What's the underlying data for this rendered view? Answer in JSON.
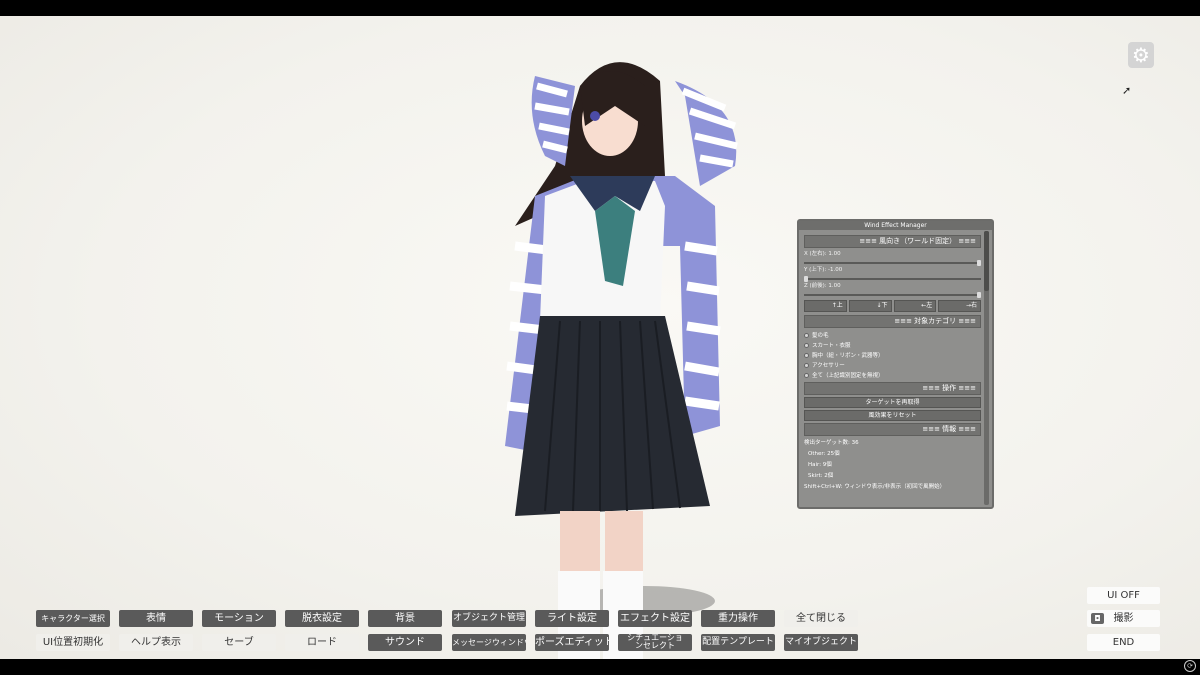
{
  "settings_icon": "gear-icon",
  "wind_panel": {
    "title": "Wind Effect Manager",
    "direction_header": "≡≡≡ 風向き（ワールド固定） ≡≡≡",
    "x_label": "X (左右): 1.00",
    "y_label": "Y (上下): -1.00",
    "z_label": "Z (前後): 1.00",
    "x_value": 1.0,
    "y_value": -1.0,
    "z_value": 1.0,
    "dir_up": "↑上",
    "dir_down": "↓下",
    "dir_left": "←左",
    "dir_right": "→右",
    "category_header": "≡≡≡ 対象カテゴリ ≡≡≡",
    "categories": [
      "髪の毛",
      "スカート・衣服",
      "胸中（紐・リボン・武器等）",
      "アクセサリー",
      "全て（上記識別固定を無視）"
    ],
    "ops_header": "≡≡≡ 操作 ≡≡≡",
    "retarget_button": "ターゲットを再取得",
    "reset_button": "風効果をリセット",
    "info_header": "≡≡≡ 情報 ≡≡≡",
    "detect_count": "検出ターゲット数: 36",
    "other_count": "Other: 25個",
    "hair_count": "Hair: 9個",
    "skirt_count": "Skirt: 2個",
    "hint": "Shift+Ctrl+W: ウィンドウ表示/非表示（初回で風開始）"
  },
  "toolbar": {
    "row1": [
      "キャラクター選択",
      "表情",
      "モーション",
      "脱衣設定",
      "背景",
      "オブジェクト管理",
      "ライト設定",
      "エフェクト設定",
      "重力操作",
      "全て閉じる"
    ],
    "row2": [
      "UI位置初期化",
      "ヘルプ表示",
      "セーブ",
      "ロード",
      "サウンド",
      "メッセージウィンドウ",
      "ポーズエディット",
      "シチュエーションセレクト",
      "配置テンプレート",
      "マイオブジェクト"
    ]
  },
  "right_buttons": {
    "ui_off": "UI OFF",
    "capture": "撮影",
    "end": "END"
  },
  "colors": {
    "dark_button": "#5a5a5a",
    "light_button": "#f0efeb",
    "panel_bg": "#8f8f8d"
  }
}
